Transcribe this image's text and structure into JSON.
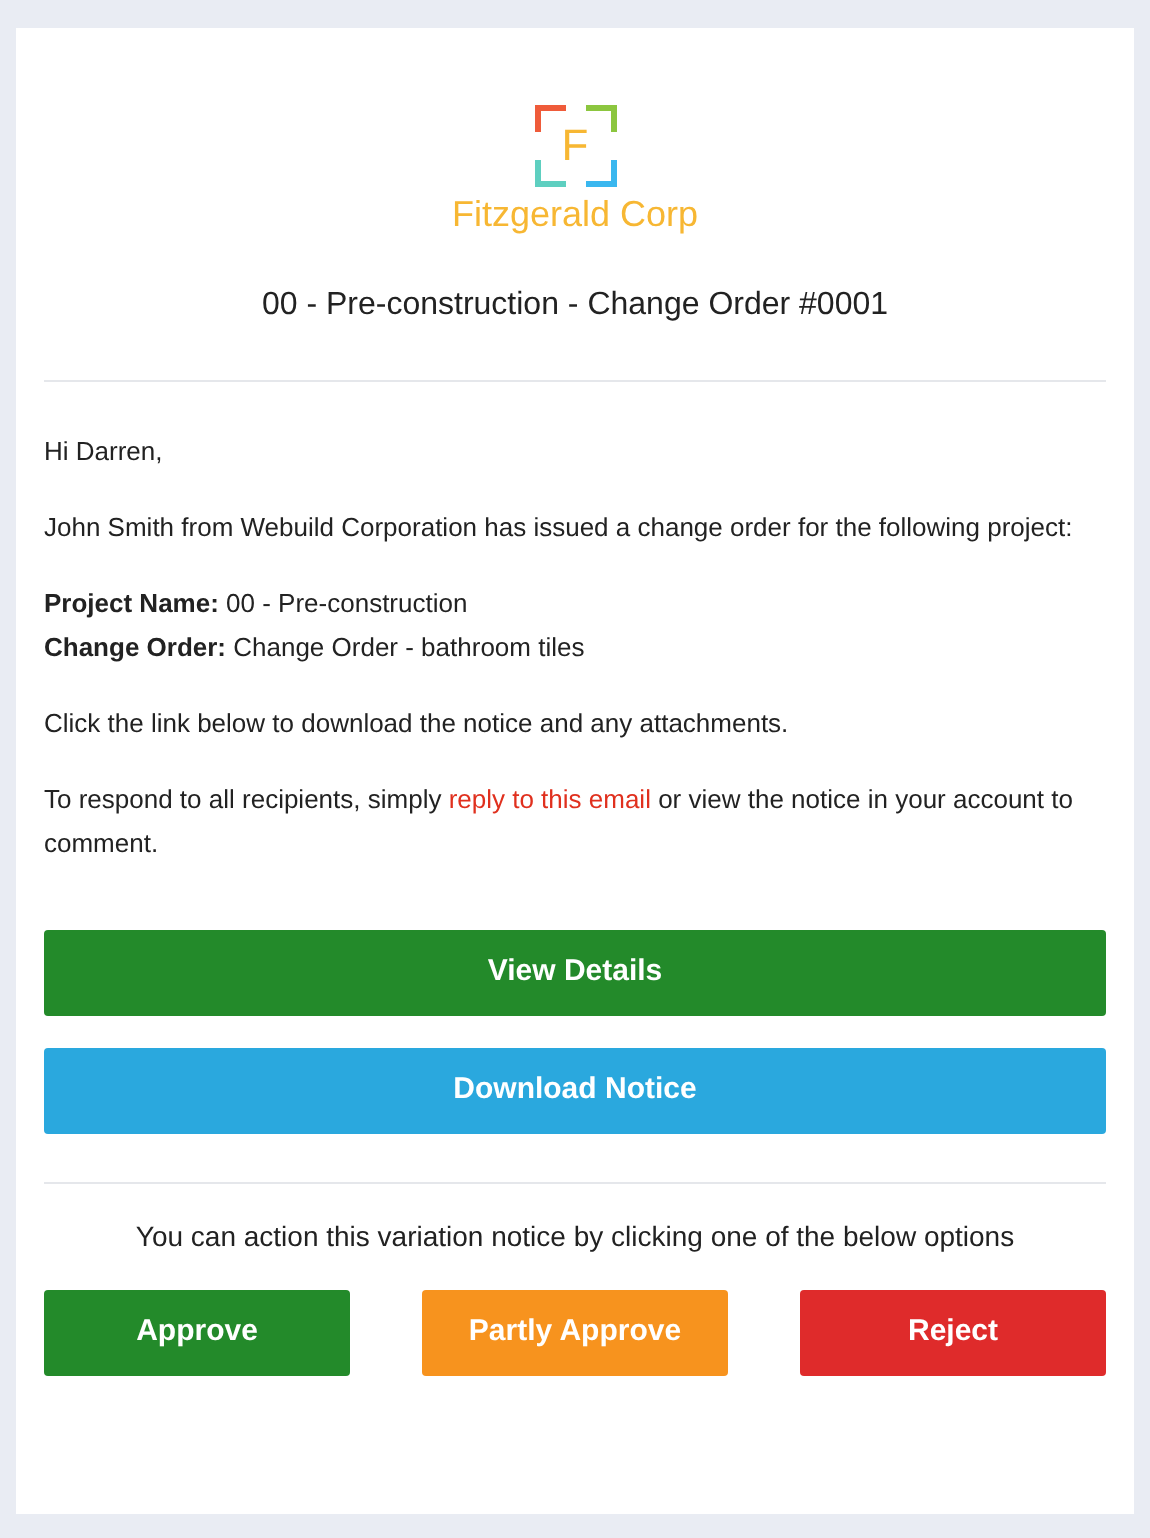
{
  "logo": {
    "letter": "F",
    "name": "Fitzgerald Corp"
  },
  "title": "00 - Pre-construction - Change Order #0001",
  "greeting": "Hi Darren,",
  "intro": "John Smith from Webuild Corporation has issued a change order for the following project:",
  "details": [
    "**Project Name:** 00 - Pre-construction",
    "**Change Order:** Change Order - bathroom tiles"
  ],
  "instruction": "Click the link below to download the notice and any attachments.",
  "respond": {
    "before": "To respond to all recipients, simply ",
    "link": "reply to this email",
    "after": " or view the notice in your account to comment."
  },
  "main_buttons": [
    {
      "label": "View Details",
      "kind": "green"
    },
    {
      "label": "Download Notice",
      "kind": "blue"
    }
  ],
  "action_prompt": "You can action this variation notice by clicking one of the below options",
  "action_buttons": [
    {
      "label": "Approve",
      "kind": "green"
    },
    {
      "label": "Partly Approve",
      "kind": "orange"
    },
    {
      "label": "Reject",
      "kind": "red"
    }
  ]
}
